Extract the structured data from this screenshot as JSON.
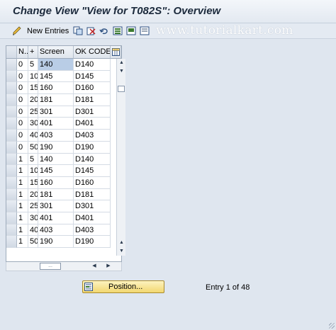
{
  "window": {
    "title": "Change View \"View for T082S\": Overview"
  },
  "toolbar": {
    "new_entries_label": "New Entries",
    "watermark": "www.tutorialkart.com",
    "icons": [
      "edit-pen-icon",
      "copy-as-icon",
      "delete-icon",
      "undo-icon",
      "select-all-icon",
      "select-block-icon",
      "deselect-all-icon"
    ]
  },
  "table": {
    "headers": [
      "N..",
      "+",
      "Screen",
      "OK CODE"
    ],
    "settings_icon": "table-settings-icon",
    "rows": [
      [
        "0",
        "5",
        "140",
        "D140"
      ],
      [
        "0",
        "10",
        "145",
        "D145"
      ],
      [
        "0",
        "15",
        "160",
        "D160"
      ],
      [
        "0",
        "20",
        "181",
        "D181"
      ],
      [
        "0",
        "25",
        "301",
        "D301"
      ],
      [
        "0",
        "30",
        "401",
        "D401"
      ],
      [
        "0",
        "40",
        "403",
        "D403"
      ],
      [
        "0",
        "50",
        "190",
        "D190"
      ],
      [
        "1",
        "5",
        "140",
        "D140"
      ],
      [
        "1",
        "10",
        "145",
        "D145"
      ],
      [
        "1",
        "15",
        "160",
        "D160"
      ],
      [
        "1",
        "20",
        "181",
        "D181"
      ],
      [
        "1",
        "25",
        "301",
        "D301"
      ],
      [
        "1",
        "30",
        "401",
        "D401"
      ],
      [
        "1",
        "40",
        "403",
        "D403"
      ],
      [
        "1",
        "50",
        "190",
        "D190"
      ]
    ],
    "hscroll_thumb": "..."
  },
  "footer": {
    "position_button_label": "Position...",
    "entry_info": "Entry 1 of 48"
  },
  "colors": {
    "accent_button": "#f2d770",
    "selection": "#b9cde6"
  }
}
